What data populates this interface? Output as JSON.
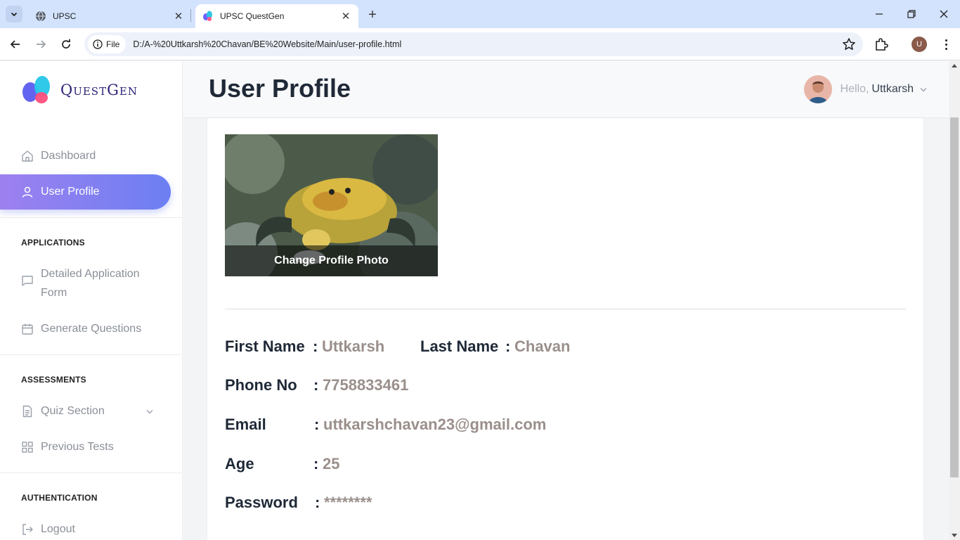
{
  "browser": {
    "tabs": [
      {
        "title": "UPSC",
        "active": false,
        "icon": "globe-icon"
      },
      {
        "title": "UPSC QuestGen",
        "active": true,
        "icon": "questgen-logo-icon"
      }
    ],
    "site_chip": "File",
    "url": "D:/A-%20Uttkarsh%20Chavan/BE%20Website/Main/user-profile.html",
    "profile_initial": "U"
  },
  "brand": {
    "name": "QuestGen"
  },
  "sidebar": {
    "top_items": [
      {
        "label": "Dashboard",
        "icon": "home-icon"
      },
      {
        "label": "User Profile",
        "icon": "user-icon",
        "active": true
      }
    ],
    "sections": [
      {
        "title": "APPLICATIONS",
        "items": [
          {
            "label": "Detailed Application Form",
            "icon": "message-square-icon"
          },
          {
            "label": "Generate Questions",
            "icon": "calendar-icon"
          }
        ]
      },
      {
        "title": "ASSESSMENTS",
        "items": [
          {
            "label": "Quiz Section",
            "icon": "file-text-icon",
            "expandable": true
          },
          {
            "label": "Previous Tests",
            "icon": "grid-icon"
          }
        ]
      },
      {
        "title": "AUTHENTICATION",
        "items": [
          {
            "label": "Logout",
            "icon": "logout-icon"
          }
        ]
      }
    ]
  },
  "header": {
    "title": "User Profile",
    "greeting": "Hello,",
    "user_name": "Uttkarsh"
  },
  "profile": {
    "photo_button": "Change Profile Photo",
    "first_name_label": "First Name",
    "first_name": "Uttkarsh",
    "last_name_label": "Last Name",
    "last_name": "Chavan",
    "phone_label": "Phone No",
    "phone": "7758833461",
    "email_label": "Email",
    "email": "uttkarshchavan23@gmail.com",
    "age_label": "Age",
    "age": "25",
    "password_label": "Password",
    "password": "********",
    "separator": ":"
  },
  "colors": {
    "accent_gradient_start": "#9d80f0",
    "accent_gradient_end": "#6c7ff2",
    "brand_text": "#2b2277",
    "value_text": "#9a8f8b"
  }
}
